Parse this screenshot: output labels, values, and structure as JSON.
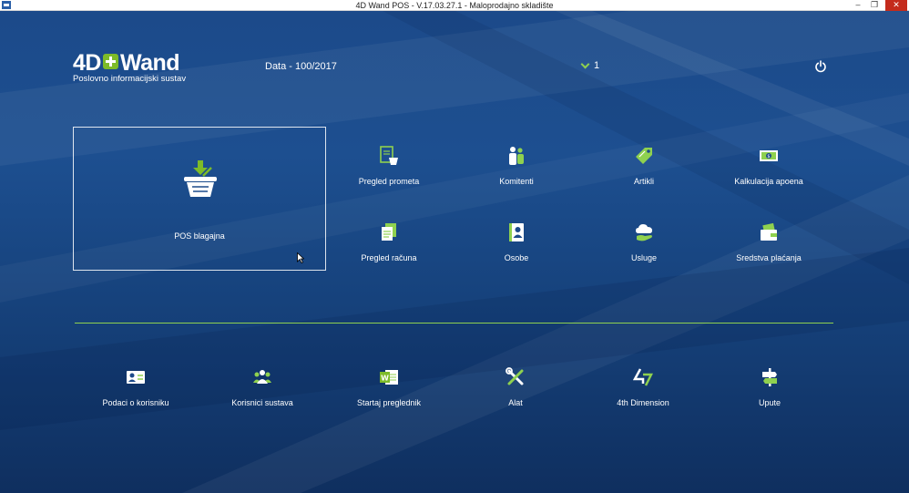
{
  "window": {
    "title": "4D Wand POS - V.17.03.27.1 - Maloprodajno skladište",
    "minimize_glyph": "–",
    "restore_glyph": "❐",
    "close_glyph": "✕"
  },
  "header": {
    "logo_brand_left": "4D",
    "logo_brand_right": "Wand",
    "logo_subtitle": "Poslovno informacijski sustav",
    "database_label": "Data - 100/2017",
    "user_value": "1",
    "power_icon": "power-icon"
  },
  "main_tile": {
    "label": "POS blagajna",
    "icon": "basket-download-icon"
  },
  "tiles": [
    {
      "label": "Pregled prometa",
      "icon": "document-basket-icon"
    },
    {
      "label": "Komitenti",
      "icon": "people-icon"
    },
    {
      "label": "Artikli",
      "icon": "price-tag-icon"
    },
    {
      "label": "Kalkulacija apoena",
      "icon": "banknote-icon"
    },
    {
      "label": "Pregled računa",
      "icon": "documents-icon"
    },
    {
      "label": "Osobe",
      "icon": "contact-book-icon"
    },
    {
      "label": "Usluge",
      "icon": "cloud-hand-icon"
    },
    {
      "label": "Sredstva plaćanja",
      "icon": "wallet-icon"
    }
  ],
  "bottom": [
    {
      "label": "Podaci o korisniku",
      "icon": "id-card-icon"
    },
    {
      "label": "Korisnici sustava",
      "icon": "users-group-icon"
    },
    {
      "label": "Startaj preglednik",
      "icon": "word-viewer-icon"
    },
    {
      "label": "Alat",
      "icon": "tools-icon"
    },
    {
      "label": "4th Dimension",
      "icon": "4d-logo-icon"
    },
    {
      "label": "Upute",
      "icon": "signpost-icon"
    }
  ],
  "colors": {
    "accent_green": "#8fd14f",
    "background_blue": "#1c4a8a",
    "text": "#ffffff"
  }
}
